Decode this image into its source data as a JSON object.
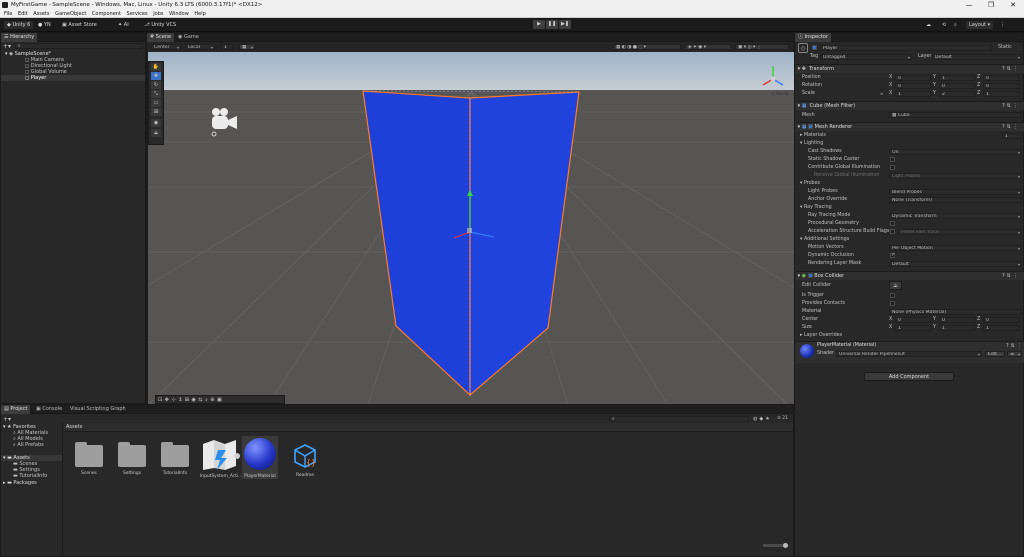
{
  "window": {
    "title": "MyFirstGame - SampleScene - Windows, Mac, Linux - Unity 6.3 LTS (6000.3.17f1)* <DX12>",
    "controls": [
      "—",
      "❐",
      "✕"
    ]
  },
  "menu": [
    "File",
    "Edit",
    "Assets",
    "GameObject",
    "Component",
    "Services",
    "Jobs",
    "Window",
    "Help"
  ],
  "toolbar": {
    "account": "Unity 6",
    "user": "YN",
    "asset_store": "Asset Store",
    "ai": "AI",
    "vcs": "Unity VCS",
    "play": "▶",
    "pause": "❚❚",
    "step": "▶❚",
    "layout": "Layout"
  },
  "hierarchy": {
    "tab": "Hierarchy",
    "items": [
      {
        "label": "SampleScene*"
      },
      {
        "label": "Main Camera"
      },
      {
        "label": "Directional Light"
      },
      {
        "label": "Global Volume"
      },
      {
        "label": "Player"
      }
    ]
  },
  "scene": {
    "tabs": [
      "Scene",
      "Game"
    ],
    "pivot": "Center",
    "space": "Local",
    "snap": "1",
    "persp": "< Persp",
    "gizmo_labels": {
      "x": "x",
      "y": "y",
      "z": "z"
    }
  },
  "inspector": {
    "tab": "Inspector",
    "object_name": "Player",
    "static_label": "Static",
    "tag_label": "Tag",
    "tag": "Untagged",
    "layer_label": "Layer",
    "layer": "Default",
    "transform": {
      "title": "Transform",
      "position_label": "Position",
      "rotation_label": "Rotation",
      "scale_label": "Scale",
      "position": [
        "0",
        "1",
        "0"
      ],
      "rotation": [
        "0",
        "0",
        "0"
      ],
      "scale": [
        "1",
        "2",
        "1"
      ],
      "axes": [
        "X",
        "Y",
        "Z"
      ]
    },
    "mesh_filter": {
      "title": "Cube (Mesh Filter)",
      "mesh_label": "Mesh",
      "mesh": "Cube"
    },
    "mesh_renderer": {
      "title": "Mesh Renderer",
      "materials_label": "Materials",
      "materials_count": "1",
      "lighting_label": "Lighting",
      "cast_shadows_label": "Cast Shadows",
      "cast_shadows": "On",
      "static_shadow_caster_label": "Static Shadow Caster",
      "contribute_gi_label": "Contribute Global Illumination",
      "receive_gi_label": "Receive Global Illumination",
      "receive_gi": "Light Probes",
      "probes_label": "Probes",
      "light_probes_label": "Light Probes",
      "light_probes": "Blend Probes",
      "anchor_override_label": "Anchor Override",
      "anchor_override": "None (Transform)",
      "ray_tracing_label": "Ray Tracing",
      "ray_tracing_mode_label": "Ray Tracing Mode",
      "ray_tracing_mode": "Dynamic Transform",
      "procedural_geometry_label": "Procedural Geometry",
      "accel_flags_label": "Acceleration Structure Build Flags",
      "accel_flags": "Prefer Fast Trace",
      "additional_label": "Additional Settings",
      "motion_vectors_label": "Motion Vectors",
      "motion_vectors": "Per Object Motion",
      "dynamic_occlusion_label": "Dynamic Occlusion",
      "rendering_layer_label": "Rendering Layer Mask",
      "rendering_layer": "Default"
    },
    "box_collider": {
      "title": "Box Collider",
      "edit_collider_label": "Edit Collider",
      "is_trigger_label": "Is Trigger",
      "provides_contacts_label": "Provides Contacts",
      "material_label": "Material",
      "material": "None (Physics Material)",
      "center_label": "Center",
      "size_label": "Size",
      "center": [
        "0",
        "0",
        "0"
      ],
      "size": [
        "1",
        "1",
        "1"
      ],
      "layer_overrides_label": "Layer Overrides"
    },
    "material": {
      "title": "PlayerMaterial (Material)",
      "shader_label": "Shader",
      "shader": "Universal Render Pipeline/Lit",
      "edit": "Edit..."
    },
    "add_component": "Add Component"
  },
  "project": {
    "tabs": [
      "Project",
      "Console",
      "Visual Scripting Graph"
    ],
    "favorites_label": "Favorites",
    "favorites": [
      "All Materials",
      "All Models",
      "All Prefabs"
    ],
    "assets_label": "Assets",
    "asset_folders": [
      "Scenes",
      "Settings",
      "TutorialInfo"
    ],
    "packages_label": "Packages",
    "breadcrumb": "Assets",
    "hidden_count": "21",
    "items": [
      {
        "label": "Scenes",
        "kind": "folder"
      },
      {
        "label": "Settings",
        "kind": "folder"
      },
      {
        "label": "TutorialInfo",
        "kind": "folder"
      },
      {
        "label": "InputSystem_Acti...",
        "kind": "input-actions"
      },
      {
        "label": "PlayerMaterial",
        "kind": "material"
      },
      {
        "label": "Readme",
        "kind": "readme"
      }
    ]
  },
  "colors": {
    "cube_face": "#1f3fd6",
    "cube_outline": "#ff7a2a",
    "sky": "#b6c7d9",
    "ground": "#585555",
    "accent": "#3a72c9"
  }
}
